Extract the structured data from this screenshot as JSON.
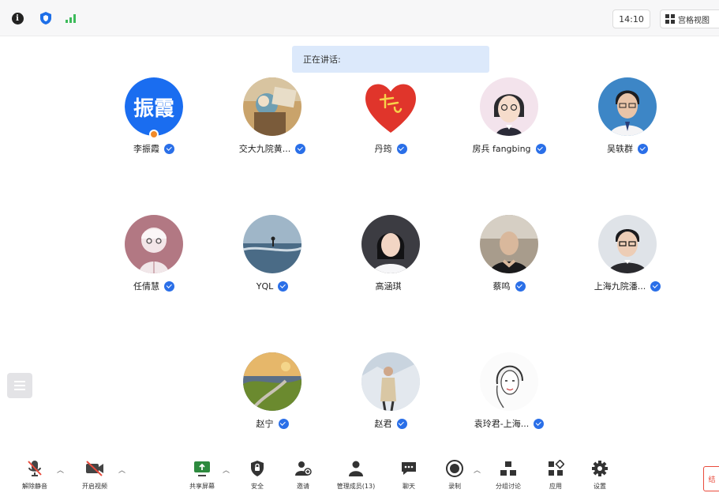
{
  "topbar": {
    "time": "14:10",
    "view_label": "宫格视图"
  },
  "speaking_label": "正在讲话:",
  "participants": [
    {
      "name": "李振霞",
      "avatar_text": "振霞",
      "avatar_type": "text",
      "host": true
    },
    {
      "name": "交大九院黄...",
      "avatar_type": "photo"
    },
    {
      "name": "丹筠",
      "avatar_type": "heart"
    },
    {
      "name": "房兵 fangbing",
      "avatar_type": "illustration"
    },
    {
      "name": "吴轶群",
      "avatar_type": "photo"
    },
    {
      "name": "任倩慧",
      "avatar_type": "illustration"
    },
    {
      "name": "YQL",
      "avatar_type": "photo"
    },
    {
      "name": "高涵琪",
      "avatar_type": "photo"
    },
    {
      "name": "蔡鸣",
      "avatar_type": "photo"
    },
    {
      "name": "上海九院潘...",
      "avatar_type": "photo"
    },
    {
      "name": "赵宁",
      "avatar_type": "photo"
    },
    {
      "name": "赵君",
      "avatar_type": "photo"
    },
    {
      "name": "袁玲君-上海...",
      "avatar_type": "sketch"
    }
  ],
  "toolbar": {
    "unmute": "解除静音",
    "start_video": "开启视频",
    "share_screen": "共享屏幕",
    "security": "安全",
    "invite": "邀请",
    "manage_members": "管理成员(13)",
    "chat": "聊天",
    "record": "录制",
    "breakout": "分组讨论",
    "apps": "应用",
    "settings": "设置"
  },
  "edge_tab": "结",
  "colors": {
    "accent": "#2a6fe8",
    "speaking_bg": "#dce9fb",
    "muted_red": "#e94b3c"
  }
}
